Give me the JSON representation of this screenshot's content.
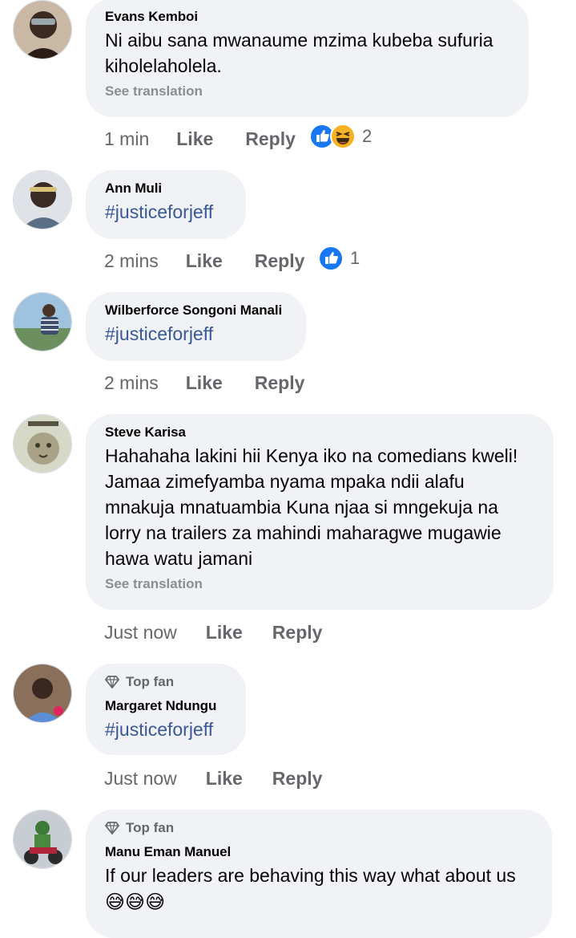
{
  "comments": [
    {
      "author": "Evans Kemboi",
      "text": "Ni aibu sana mwanaume mzima kubeba sufuria kiholelaholela.",
      "see_translation": "See translation",
      "time": "1 min",
      "like": "Like",
      "reply": "Reply",
      "reaction_count": "2",
      "reactions": [
        "like-reaction-icon",
        "haha-reaction-icon"
      ]
    },
    {
      "author": "Ann Muli",
      "text": "#justiceforjeff",
      "time": "2 mins",
      "like": "Like",
      "reply": "Reply",
      "reaction_count": "1",
      "reactions": [
        "like-reaction-icon"
      ]
    },
    {
      "author": "Wilberforce Songoni Manali",
      "text": "#justiceforjeff",
      "time": "2 mins",
      "like": "Like",
      "reply": "Reply"
    },
    {
      "author": "Steve Karisa",
      "text": "Hahahaha lakini hii Kenya iko na comedians kweli! Jamaa zimefyamba nyama mpaka ndii alafu mnakuja mnatuambia Kuna njaa si mngekuja na lorry na trailers za mahindi maharagwe mugawie hawa watu jamani",
      "see_translation": "See translation",
      "time": "Just now",
      "like": "Like",
      "reply": "Reply"
    },
    {
      "badge": "Top fan",
      "author": "Margaret Ndungu",
      "text": "#justiceforjeff",
      "time": "Just now",
      "like": "Like",
      "reply": "Reply"
    },
    {
      "badge": "Top fan",
      "author": "Manu Eman Manuel",
      "text": "If our leaders are behaving this way what about us",
      "emojis": [
        "😅",
        "😅",
        "😅"
      ]
    }
  ],
  "colors": {
    "bubble": "#f0f2f5",
    "meta": "#65676b",
    "hashtag": "#385898",
    "like_blue": "#1877f2",
    "haha_yellow": "#f7b125"
  }
}
